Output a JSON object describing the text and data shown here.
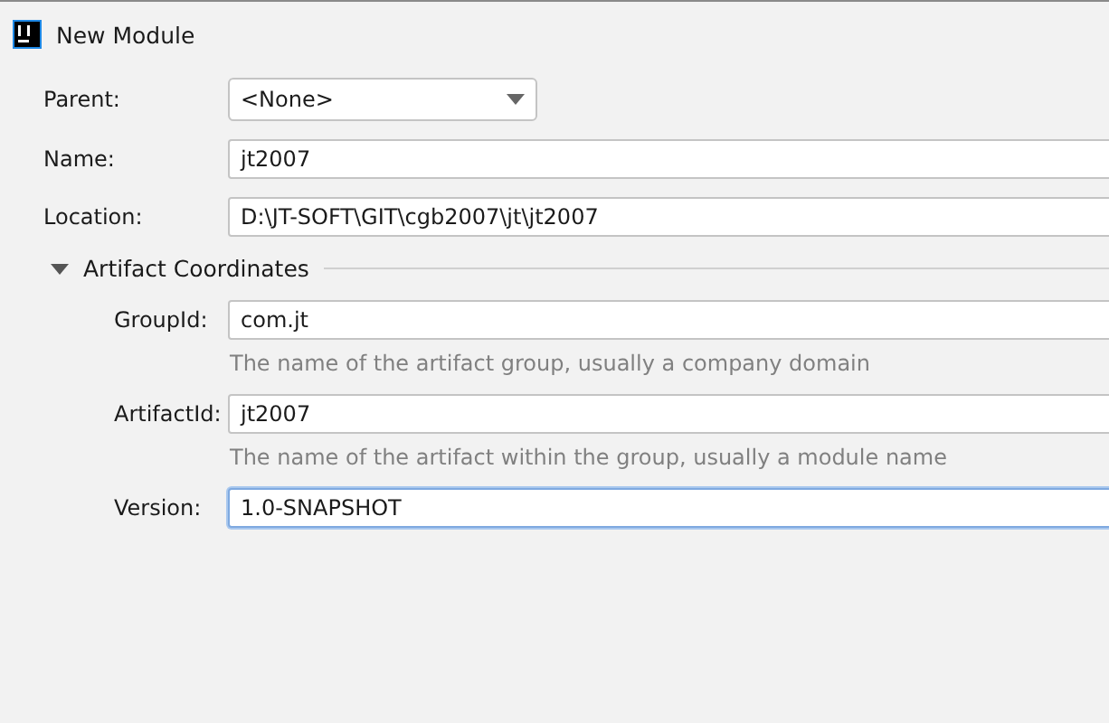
{
  "window": {
    "title": "New Module"
  },
  "fields": [
    {
      "kind": "dropdown",
      "label": "Parent:",
      "value": "<None>"
    },
    {
      "kind": "text",
      "label": "Name:",
      "value": "jt2007",
      "focused": false
    },
    {
      "kind": "text",
      "label": "Location:",
      "value": "D:\\JT-SOFT\\GIT\\cgb2007\\jt\\jt2007",
      "focused": false
    }
  ],
  "section": {
    "title": "Artifact Coordinates",
    "expanded": true,
    "fields": [
      {
        "label": "GroupId:",
        "value": "com.jt",
        "focused": false,
        "hint": "The name of the artifact group, usually a company domain"
      },
      {
        "label": "ArtifactId:",
        "value": "jt2007",
        "focused": false,
        "hint": "The name of the artifact within the group, usually a module name"
      },
      {
        "label": "Version:",
        "value": "1.0-SNAPSHOT",
        "focused": true
      }
    ]
  }
}
